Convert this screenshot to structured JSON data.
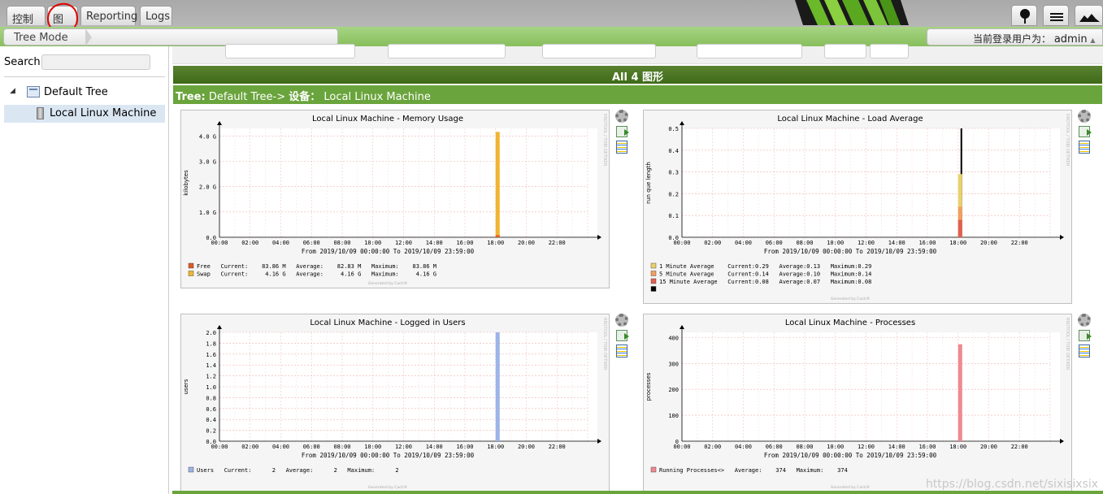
{
  "tabs": [
    {
      "label": "控制台"
    },
    {
      "label": "图形"
    },
    {
      "label": "Reporting"
    },
    {
      "label": "Logs"
    }
  ],
  "breadcrumb": {
    "label": "Tree Mode"
  },
  "user": {
    "prefix": "当前登录用户为：",
    "name": "admin"
  },
  "sidebar": {
    "search_label": "Search",
    "search_value": "",
    "tree": {
      "label": "Default Tree",
      "node": "Local Linux Machine"
    }
  },
  "main": {
    "all_label": "All 4 图形",
    "tree_prefix": "Tree:",
    "tree_path": "Default Tree-> ",
    "device_label": "设备：",
    "device_name": "Local Linux Machine"
  },
  "watermark": "https://blog.csdn.net/sixisixsix",
  "colors": {
    "accent_green": "#6aa43c",
    "dark_green": "#4a7624"
  },
  "chart_data": [
    {
      "type": "area",
      "title": "Local Linux Machine - Memory Usage",
      "ylabel": "kilobytes",
      "xlabel": "From 2019/10/09 00:00:00 To 2019/10/09 23:59:00",
      "x_ticks": [
        "00:00",
        "02:00",
        "04:00",
        "06:00",
        "08:00",
        "10:00",
        "12:00",
        "14:00",
        "16:00",
        "18:00",
        "20:00",
        "22:00"
      ],
      "y_ticks": [
        "0.0",
        "1.0 G",
        "2.0 G",
        "3.0 G",
        "4.0 G"
      ],
      "ylim": [
        0,
        4.3
      ],
      "spike_hour": 18,
      "series": [
        {
          "name": "Free",
          "color": "#e05a1e",
          "value": 0.08,
          "legend": "Free   Current:    83.86 M   Average:    82.83 M   Maximum:    83.86 M"
        },
        {
          "name": "Swap",
          "color": "#f0b530",
          "value": 4.16,
          "legend": "Swap   Current:     4.16 G   Average:     4.16 G   Maximum:     4.16 G"
        }
      ],
      "vertical_label": "RRDTOOL / TOBI OETIKER",
      "footer": "Generated by Cacti®"
    },
    {
      "type": "area",
      "title": "Local Linux Machine - Load Average",
      "ylabel": "run que length",
      "xlabel": "From 2019/10/09 00:00:00 To 2019/10/09 23:59:00",
      "x_ticks": [
        "00:00",
        "02:00",
        "04:00",
        "06:00",
        "08:00",
        "10:00",
        "12:00",
        "14:00",
        "16:00",
        "18:00",
        "20:00",
        "22:00"
      ],
      "y_ticks": [
        "0.0",
        "0.1",
        "0.2",
        "0.3",
        "0.4",
        "0.5"
      ],
      "ylim": [
        0,
        0.5
      ],
      "spike_hour": 18,
      "series": [
        {
          "name": "1 Minute Average",
          "color": "#e8d26a",
          "value": 0.29,
          "legend": "1 Minute Average    Current:0.29   Average:0.13   Maximum:0.29"
        },
        {
          "name": "5 Minute Average",
          "color": "#f0a060",
          "value": 0.14,
          "legend": "5 Minute Average    Current:0.14   Average:0.10   Maximum:0.14"
        },
        {
          "name": "15 Minute Average",
          "color": "#e06050",
          "value": 0.08,
          "legend": "15 Minute Average   Current:0.08   Average:0.07   Maximum:0.08"
        },
        {
          "name": "",
          "color": "#000000",
          "value": 0.5,
          "legend": ""
        }
      ],
      "vertical_label": "RRDTOOL / TOBI OETIKER",
      "footer": "Generated by Cacti®"
    },
    {
      "type": "area",
      "title": "Local Linux Machine - Logged in Users",
      "ylabel": "users",
      "xlabel": "From 2019/10/09 00:00:00 To 2019/10/09 23:59:00",
      "x_ticks": [
        "00:00",
        "02:00",
        "04:00",
        "06:00",
        "08:00",
        "10:00",
        "12:00",
        "14:00",
        "16:00",
        "18:00",
        "20:00",
        "22:00"
      ],
      "y_ticks": [
        "0.0",
        "0.2",
        "0.4",
        "0.6",
        "0.8",
        "1.0",
        "1.2",
        "1.4",
        "1.6",
        "1.8",
        "2.0"
      ],
      "ylim": [
        0,
        2.0
      ],
      "spike_hour": 18,
      "series": [
        {
          "name": "Users",
          "color": "#9cb4e8",
          "value": 2,
          "legend": "Users   Current:      2   Average:      2   Maximum:      2"
        }
      ],
      "vertical_label": "RRDTOOL / TOBI OETIKER",
      "footer": "Generated by Cacti®"
    },
    {
      "type": "area",
      "title": "Local Linux Machine - Processes",
      "ylabel": "processes",
      "xlabel": "From 2019/10/09 00:00:00 To 2019/10/09 23:59:00",
      "x_ticks": [
        "00:00",
        "02:00",
        "04:00",
        "06:00",
        "08:00",
        "10:00",
        "12:00",
        "14:00",
        "16:00",
        "18:00",
        "20:00",
        "22:00"
      ],
      "y_ticks": [
        "0",
        "100",
        "200",
        "300",
        "400"
      ],
      "ylim": [
        0,
        420
      ],
      "spike_hour": 18,
      "series": [
        {
          "name": "Running Processes<>",
          "color": "#f08890",
          "value": 374,
          "legend": "Running Processes<>   Average:    374   Maximum:    374"
        }
      ],
      "vertical_label": "RRDTOOL / TOBI OETIKER",
      "footer": "Generated by Cacti®"
    }
  ]
}
